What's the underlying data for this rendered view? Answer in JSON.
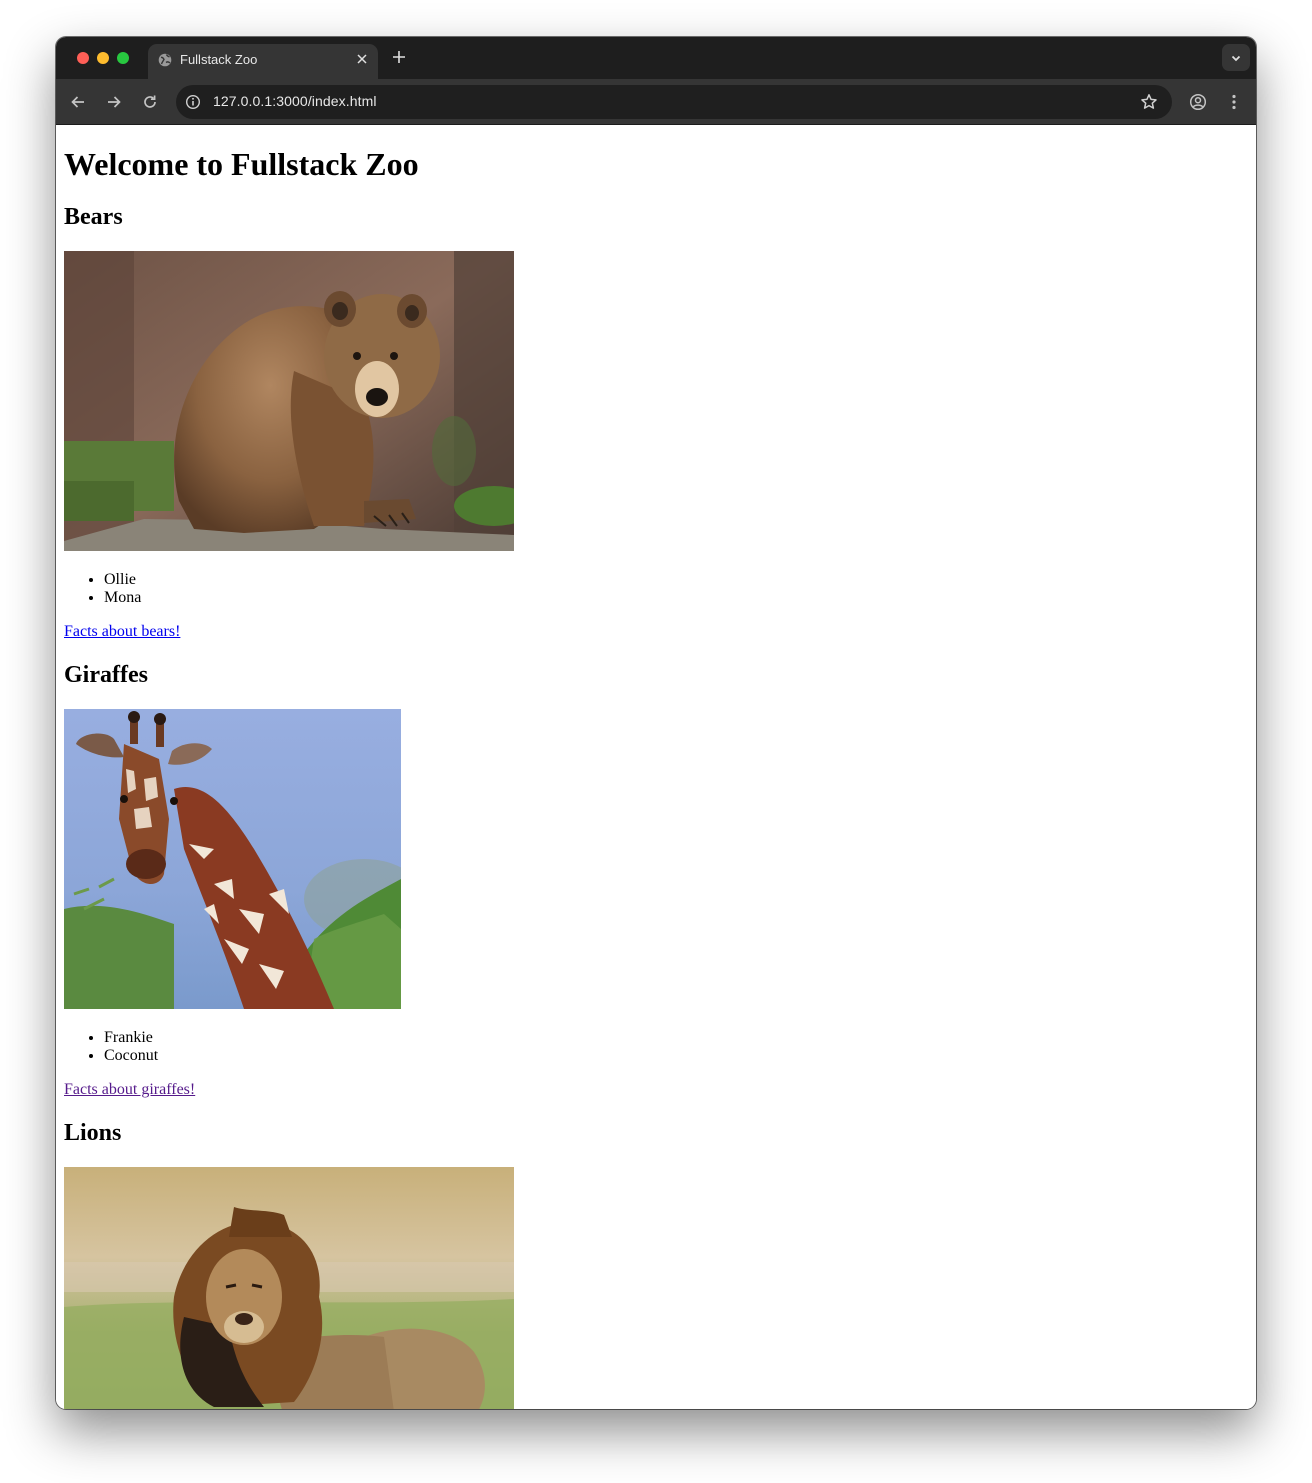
{
  "browser": {
    "tab_title": "Fullstack Zoo",
    "url": "127.0.0.1:3000/index.html"
  },
  "page": {
    "heading": "Welcome to Fullstack Zoo",
    "sections": [
      {
        "title": "Bears",
        "animals": [
          "Ollie",
          "Mona"
        ],
        "link_text": "Facts about bears!",
        "photo_alt": "brown bear"
      },
      {
        "title": "Giraffes",
        "animals": [
          "Frankie",
          "Coconut"
        ],
        "link_text": "Facts about giraffes!",
        "photo_alt": "giraffe"
      },
      {
        "title": "Lions",
        "animals": [],
        "link_text": "",
        "photo_alt": "lion"
      }
    ]
  },
  "colors": {
    "link": "#0000ee",
    "link_visited": "#551a8b",
    "tabstrip": "#1e1e1e",
    "toolbar": "#353535"
  },
  "icons": [
    "globe-icon",
    "close-icon",
    "plus-icon",
    "chevron-down-icon",
    "back-arrow-icon",
    "forward-arrow-icon",
    "reload-icon",
    "info-icon",
    "star-icon",
    "profile-icon",
    "more-vert-icon"
  ]
}
